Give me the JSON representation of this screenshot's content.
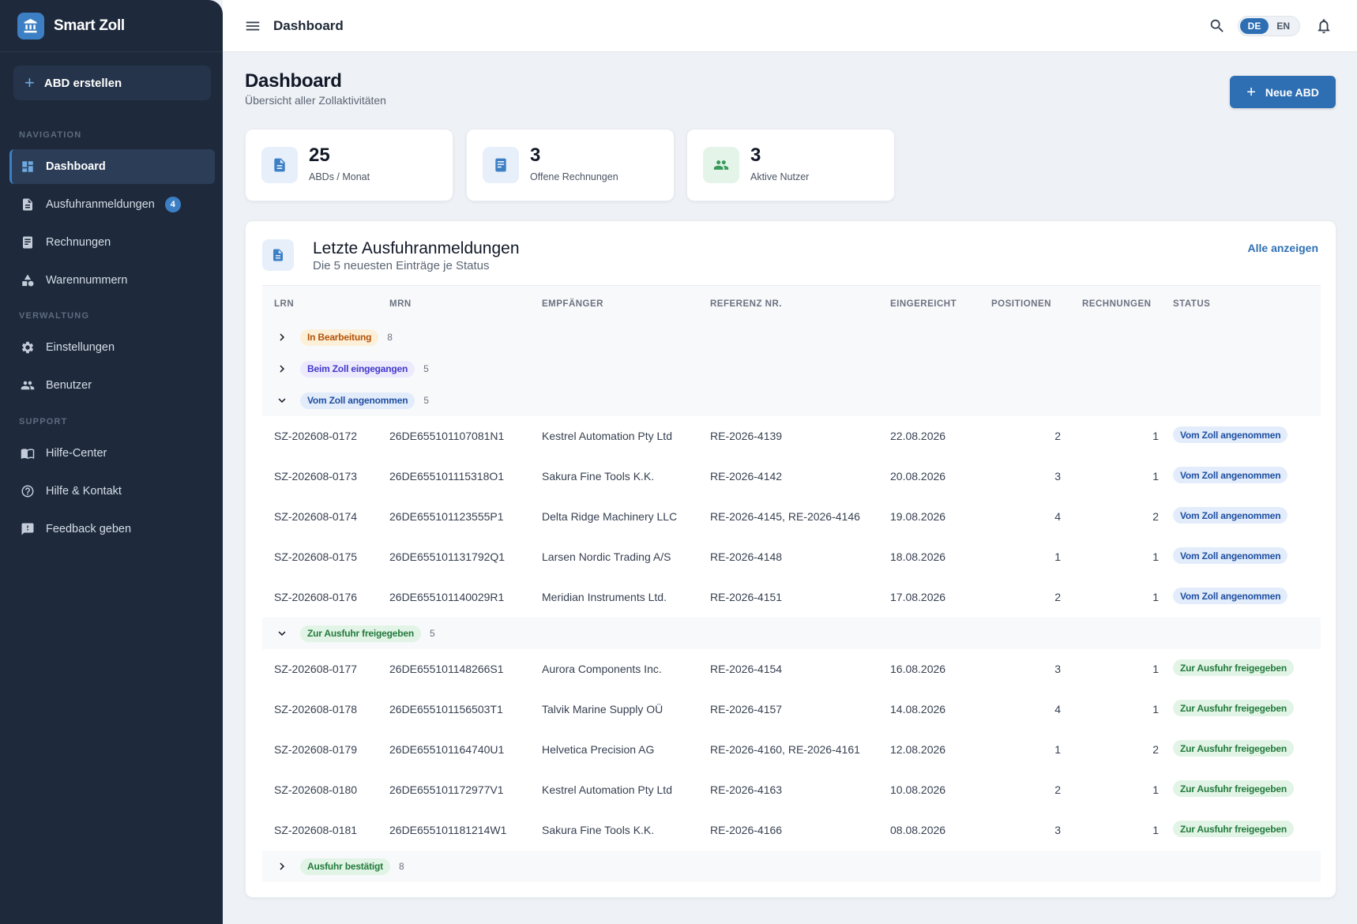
{
  "sidebar": {
    "brand": "Smart Zoll",
    "create_button": "ABD erstellen",
    "sections": {
      "navigation": "NAVIGATION",
      "verwaltung": "VERWALTUNG",
      "support": "SUPPORT"
    },
    "items": [
      {
        "label": "Dashboard"
      },
      {
        "label": "Ausfuhranmeldungen",
        "badge": "4"
      },
      {
        "label": "Rechnungen"
      },
      {
        "label": "Warennummern"
      },
      {
        "label": "Einstellungen"
      },
      {
        "label": "Benutzer"
      },
      {
        "label": "Hilfe-Center"
      },
      {
        "label": "Hilfe & Kontakt"
      },
      {
        "label": "Feedback geben"
      }
    ]
  },
  "topbar": {
    "title": "Dashboard",
    "lang_de": "DE",
    "lang_en": "EN"
  },
  "page": {
    "title": "Dashboard",
    "subtitle": "Übersicht aller Zollaktivitäten",
    "new_button": "Neue ABD"
  },
  "stats": [
    {
      "value": "25",
      "label": "ABDs / Monat"
    },
    {
      "value": "3",
      "label": "Offene Rechnungen"
    },
    {
      "value": "3",
      "label": "Aktive Nutzer"
    }
  ],
  "table": {
    "title": "Letzte Ausfuhranmeldungen",
    "subtitle": "Die 5 neuesten Einträge je Status",
    "link": "Alle anzeigen",
    "columns": [
      "LRN",
      "MRN",
      "EMPFÄNGER",
      "REFERENZ NR.",
      "EINGEREICHT",
      "POSITIONEN",
      "RECHNUNGEN",
      "STATUS"
    ],
    "groups": [
      {
        "label": "In Bearbeitung",
        "count": "8",
        "expanded": false
      },
      {
        "label": "Beim Zoll eingegangen",
        "count": "5",
        "expanded": false
      },
      {
        "label": "Vom Zoll angenommen",
        "count": "5",
        "expanded": true
      },
      {
        "label": "Zur Ausfuhr freigegeben",
        "count": "5",
        "expanded": true
      },
      {
        "label": "Ausfuhr bestätigt",
        "count": "8",
        "expanded": false
      }
    ],
    "rows_angenommen": [
      {
        "lrn": "SZ-202608-0172",
        "mrn": "26DE655101107081N1",
        "empf": "Kestrel Automation Pty Ltd",
        "ref": "RE-2026-4139",
        "date": "22.08.2026",
        "pos": "2",
        "rech": "1",
        "status": "Vom Zoll angenommen"
      },
      {
        "lrn": "SZ-202608-0173",
        "mrn": "26DE655101115318O1",
        "empf": "Sakura Fine Tools K.K.",
        "ref": "RE-2026-4142",
        "date": "20.08.2026",
        "pos": "3",
        "rech": "1",
        "status": "Vom Zoll angenommen"
      },
      {
        "lrn": "SZ-202608-0174",
        "mrn": "26DE655101123555P1",
        "empf": "Delta Ridge Machinery LLC",
        "ref": "RE-2026-4145, RE-2026-4146",
        "date": "19.08.2026",
        "pos": "4",
        "rech": "2",
        "status": "Vom Zoll angenommen"
      },
      {
        "lrn": "SZ-202608-0175",
        "mrn": "26DE655101131792Q1",
        "empf": "Larsen Nordic Trading A/S",
        "ref": "RE-2026-4148",
        "date": "18.08.2026",
        "pos": "1",
        "rech": "1",
        "status": "Vom Zoll angenommen"
      },
      {
        "lrn": "SZ-202608-0176",
        "mrn": "26DE655101140029R1",
        "empf": "Meridian Instruments Ltd.",
        "ref": "RE-2026-4151",
        "date": "17.08.2026",
        "pos": "2",
        "rech": "1",
        "status": "Vom Zoll angenommen"
      }
    ],
    "rows_freigegeben": [
      {
        "lrn": "SZ-202608-0177",
        "mrn": "26DE655101148266S1",
        "empf": "Aurora Components Inc.",
        "ref": "RE-2026-4154",
        "date": "16.08.2026",
        "pos": "3",
        "rech": "1",
        "status": "Zur Ausfuhr freigegeben"
      },
      {
        "lrn": "SZ-202608-0178",
        "mrn": "26DE655101156503T1",
        "empf": "Talvik Marine Supply OÜ",
        "ref": "RE-2026-4157",
        "date": "14.08.2026",
        "pos": "4",
        "rech": "1",
        "status": "Zur Ausfuhr freigegeben"
      },
      {
        "lrn": "SZ-202608-0179",
        "mrn": "26DE655101164740U1",
        "empf": "Helvetica Precision AG",
        "ref": "RE-2026-4160, RE-2026-4161",
        "date": "12.08.2026",
        "pos": "1",
        "rech": "2",
        "status": "Zur Ausfuhr freigegeben"
      },
      {
        "lrn": "SZ-202608-0180",
        "mrn": "26DE655101172977V1",
        "empf": "Kestrel Automation Pty Ltd",
        "ref": "RE-2026-4163",
        "date": "10.08.2026",
        "pos": "2",
        "rech": "1",
        "status": "Zur Ausfuhr freigegeben"
      },
      {
        "lrn": "SZ-202608-0181",
        "mrn": "26DE655101181214W1",
        "empf": "Sakura Fine Tools K.K.",
        "ref": "RE-2026-4166",
        "date": "08.08.2026",
        "pos": "3",
        "rech": "1",
        "status": "Zur Ausfuhr freigegeben"
      }
    ]
  },
  "colors": {
    "sidebar_bg": "#1e2a3c",
    "accent": "#2e6fb4",
    "page_bg": "#eef1f5"
  }
}
